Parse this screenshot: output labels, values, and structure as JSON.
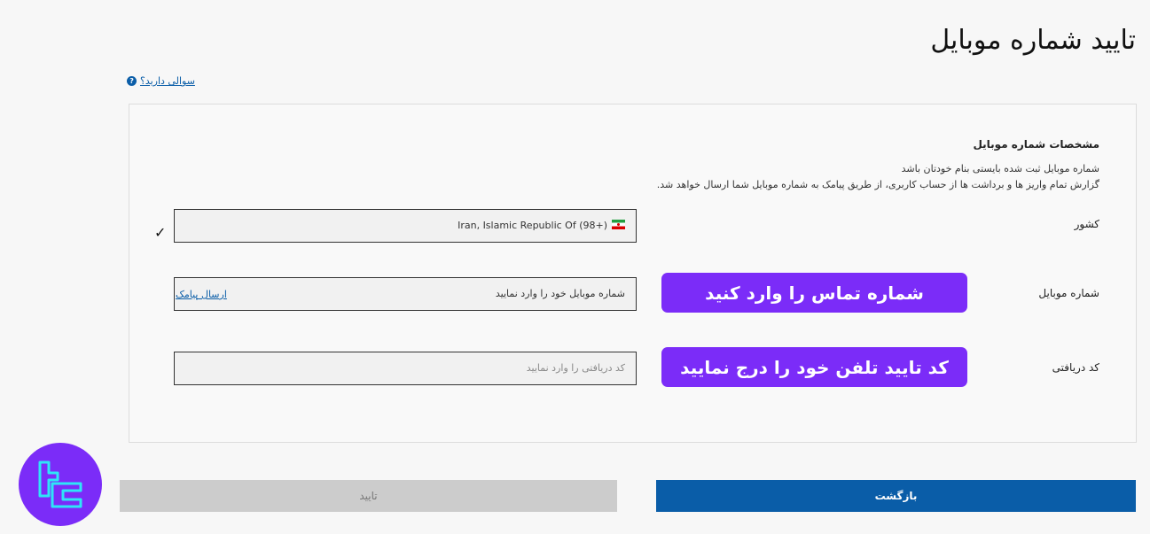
{
  "page": {
    "title": "تایید شماره موبایل"
  },
  "help": {
    "icon": "question-icon",
    "label": "سوالی دارید؟"
  },
  "card": {
    "section_title": "مشخصات شماره موبایل",
    "description_line1": "شماره موبایل ثبت شده بایستی بنام خودتان باشد",
    "description_line2": "گزارش تمام واریز ها و برداشت ها از حساب کاربری، از طریق پیامک به شماره موبایل شما ارسال خواهد شد."
  },
  "country": {
    "label": "کشور",
    "value": "Iran, Islamic Republic Of (98+)",
    "flag_icon": "iran-flag-icon"
  },
  "mobile": {
    "label": "شماره موبایل",
    "placeholder": "شماره موبایل خود را وارد نمایید",
    "send_sms_label": "ارسال پیامک",
    "callout": "شماره تماس را وارد کنید"
  },
  "code": {
    "label": "کد دریافتی",
    "placeholder": "کد دریافتی را وارد نمایید",
    "callout": "کد تایید تلفن خود را درج نمایید"
  },
  "buttons": {
    "confirm_label": "تایید",
    "back_label": "بازگشت"
  },
  "colors": {
    "accent": "#7b2cf8",
    "primary": "#0a5da8",
    "disabled": "#cccccc"
  }
}
